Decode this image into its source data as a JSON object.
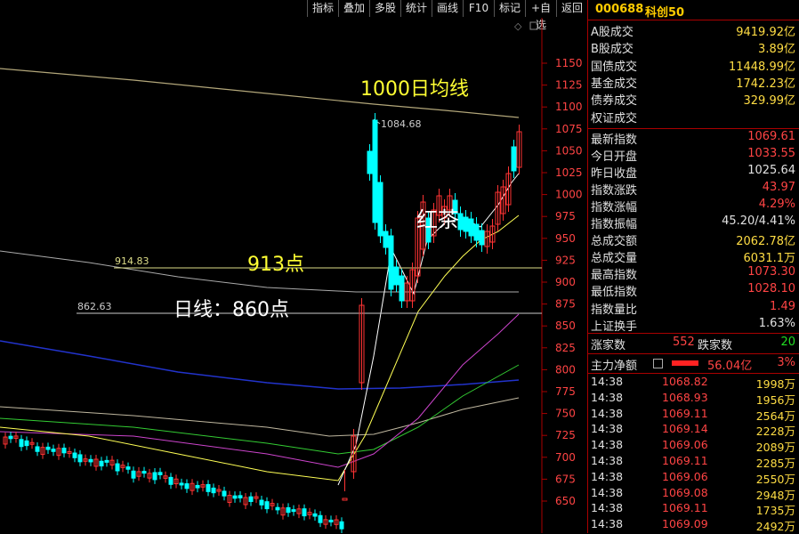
{
  "toolbar": {
    "buttons": [
      "指标",
      "叠加",
      "多股",
      "统计",
      "画线",
      "F10",
      "标记",
      "+自选",
      "返回"
    ]
  },
  "chart": {
    "price_axis_labels": [
      "1150",
      "1125",
      "1100",
      "1075",
      "1050",
      "1025",
      "1000",
      "975",
      "950",
      "925",
      "900",
      "875",
      "850",
      "825",
      "800",
      "775",
      "750",
      "725",
      "700",
      "675",
      "650"
    ],
    "peak_label": "1084.68",
    "level_label_1": "914.83",
    "level_label_2": "862.63",
    "annotation_ma1000": "1000日均线",
    "annotation_913": "913点",
    "annotation_860": "日线：860点",
    "annotation_hongcha": "红茶",
    "colors": {
      "up": "#ff3333",
      "down": "#00ffff",
      "ma_white": "#ffffff",
      "ma_yellow": "#ffff55",
      "ma_purple": "#cc44cc",
      "ma_green": "#33cc33",
      "ma_blue": "#2233cc",
      "ma_tan": "#b3a77a"
    }
  },
  "panel": {
    "stock_code": "000688",
    "stock_name": "科创50",
    "turnover": [
      {
        "label": "A股成交",
        "value": "9419.92亿"
      },
      {
        "label": "B股成交",
        "value": "3.89亿"
      },
      {
        "label": "国债成交",
        "value": "11448.99亿"
      },
      {
        "label": "基金成交",
        "value": "1742.23亿"
      },
      {
        "label": "债券成交",
        "value": "329.99亿"
      },
      {
        "label": "权证成交",
        "value": ""
      }
    ],
    "index_stats": [
      {
        "label": "最新指数",
        "value": "1069.61",
        "color": "r"
      },
      {
        "label": "今日开盘",
        "value": "1033.55",
        "color": "r"
      },
      {
        "label": "昨日收盘",
        "value": "1025.64",
        "color": "w"
      },
      {
        "label": "指数涨跌",
        "value": "43.97",
        "color": "r"
      },
      {
        "label": "指数涨幅",
        "value": "4.29%",
        "color": "r"
      },
      {
        "label": "指数振幅",
        "value": "45.20/4.41%",
        "color": "w"
      },
      {
        "label": "总成交额",
        "value": "2062.78亿",
        "color": "y"
      },
      {
        "label": "总成交量",
        "value": "6031.1万",
        "color": "y"
      },
      {
        "label": "最高指数",
        "value": "1073.30",
        "color": "r"
      },
      {
        "label": "最低指数",
        "value": "1028.10",
        "color": "r"
      },
      {
        "label": "指数量比",
        "value": "1.49",
        "color": "r"
      },
      {
        "label": "上证换手",
        "value": "1.63%",
        "color": "w"
      }
    ],
    "breadth": {
      "up_label": "涨家数",
      "up_value": "552",
      "down_label": "跌家数",
      "down_value": "20"
    },
    "main_flow": {
      "label": "主力净额",
      "value": "56.04亿",
      "pct": "3%"
    },
    "ticks": [
      {
        "time": "14:38",
        "price": "1068.82",
        "vol": "1998万"
      },
      {
        "time": "14:38",
        "price": "1068.93",
        "vol": "1956万"
      },
      {
        "time": "14:38",
        "price": "1069.11",
        "vol": "2564万"
      },
      {
        "time": "14:38",
        "price": "1069.14",
        "vol": "2228万"
      },
      {
        "time": "14:38",
        "price": "1069.06",
        "vol": "2089万"
      },
      {
        "time": "14:38",
        "price": "1069.11",
        "vol": "2285万"
      },
      {
        "time": "14:38",
        "price": "1069.06",
        "vol": "2550万"
      },
      {
        "time": "14:38",
        "price": "1069.08",
        "vol": "2948万"
      },
      {
        "time": "14:38",
        "price": "1069.11",
        "vol": "1735万"
      },
      {
        "time": "14:38",
        "price": "1069.09",
        "vol": "2492万"
      }
    ]
  }
}
